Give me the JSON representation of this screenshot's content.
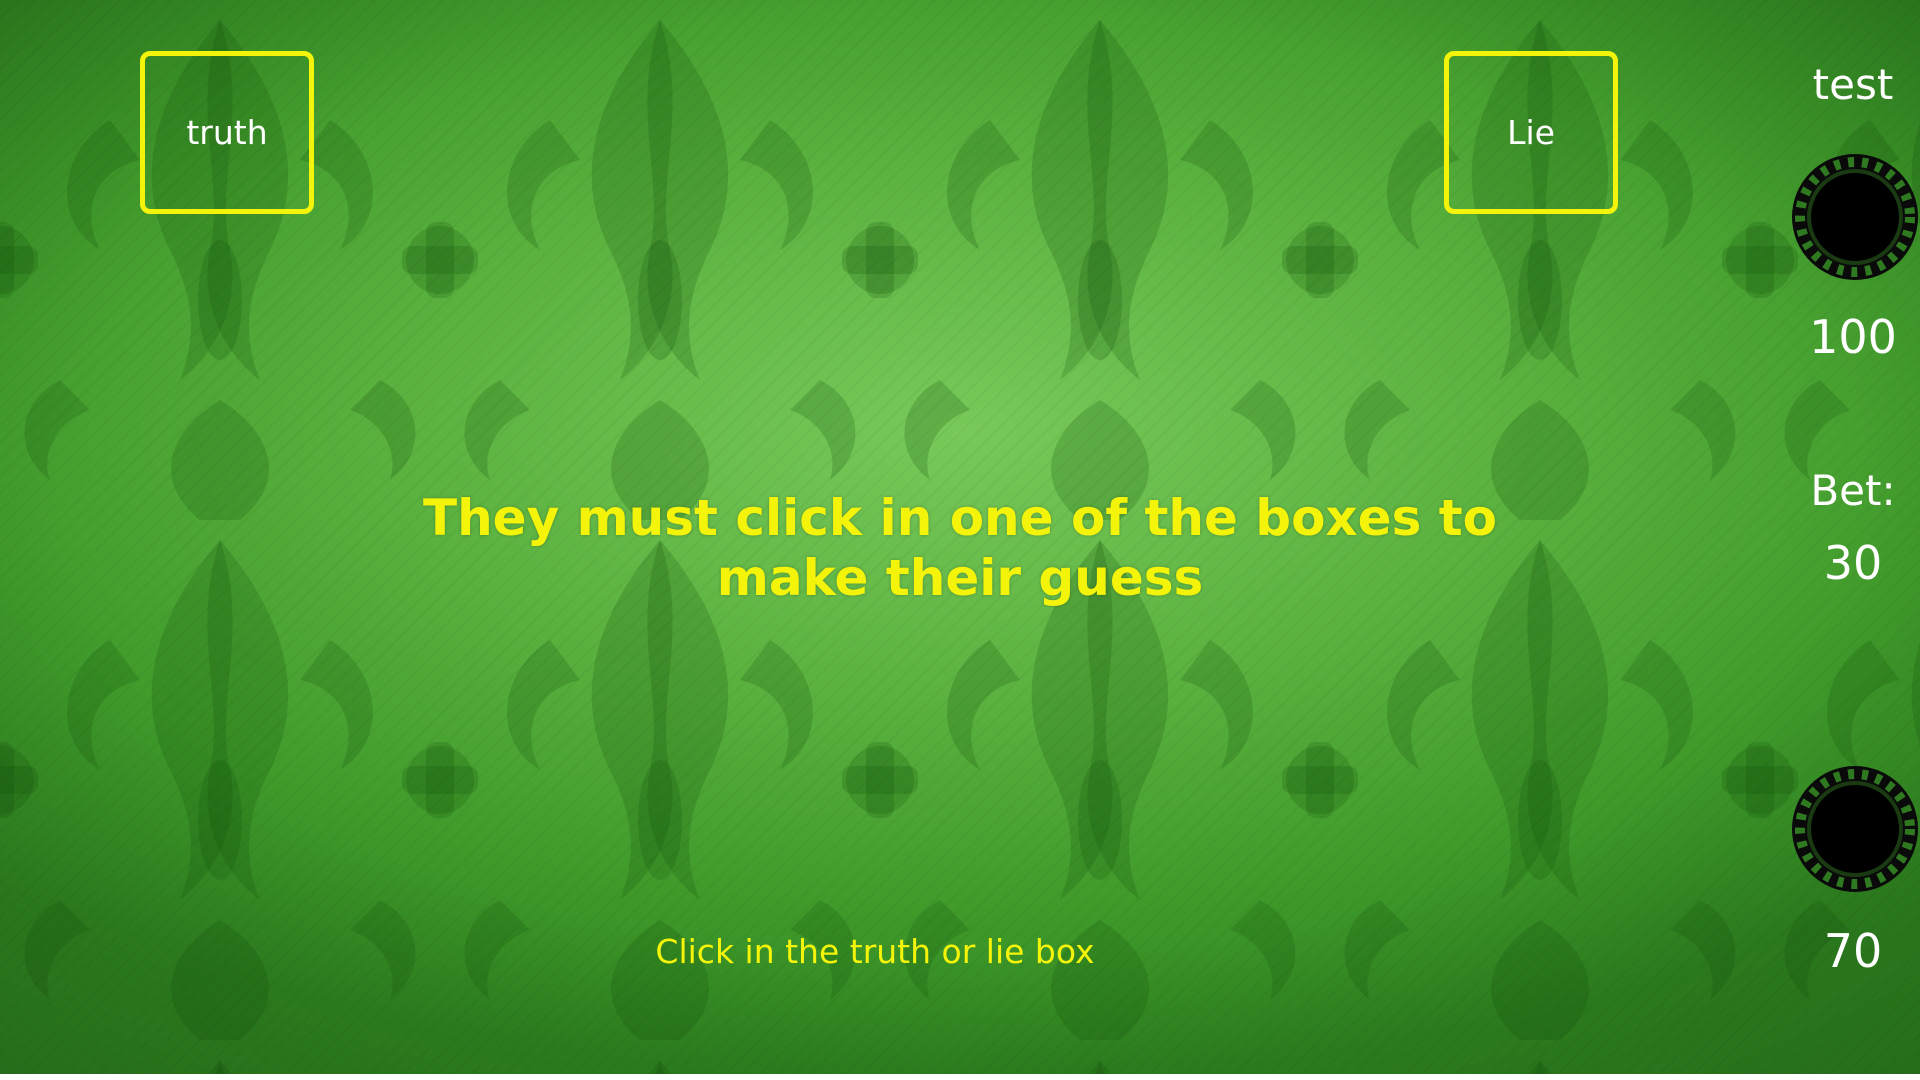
{
  "game": {
    "truth_label": "truth",
    "lie_label": "Lie",
    "instruction": "They must click in one of the boxes to make their guess",
    "hint": "Click in the truth or lie box"
  },
  "player": {
    "name": "test",
    "balance": "100",
    "bet_label": "Bet:",
    "bet_value": "30",
    "pot_value": "70"
  },
  "colors": {
    "accent_yellow": "#f4f40a",
    "background_green": "#5cb340",
    "chip_black": "#000000"
  }
}
